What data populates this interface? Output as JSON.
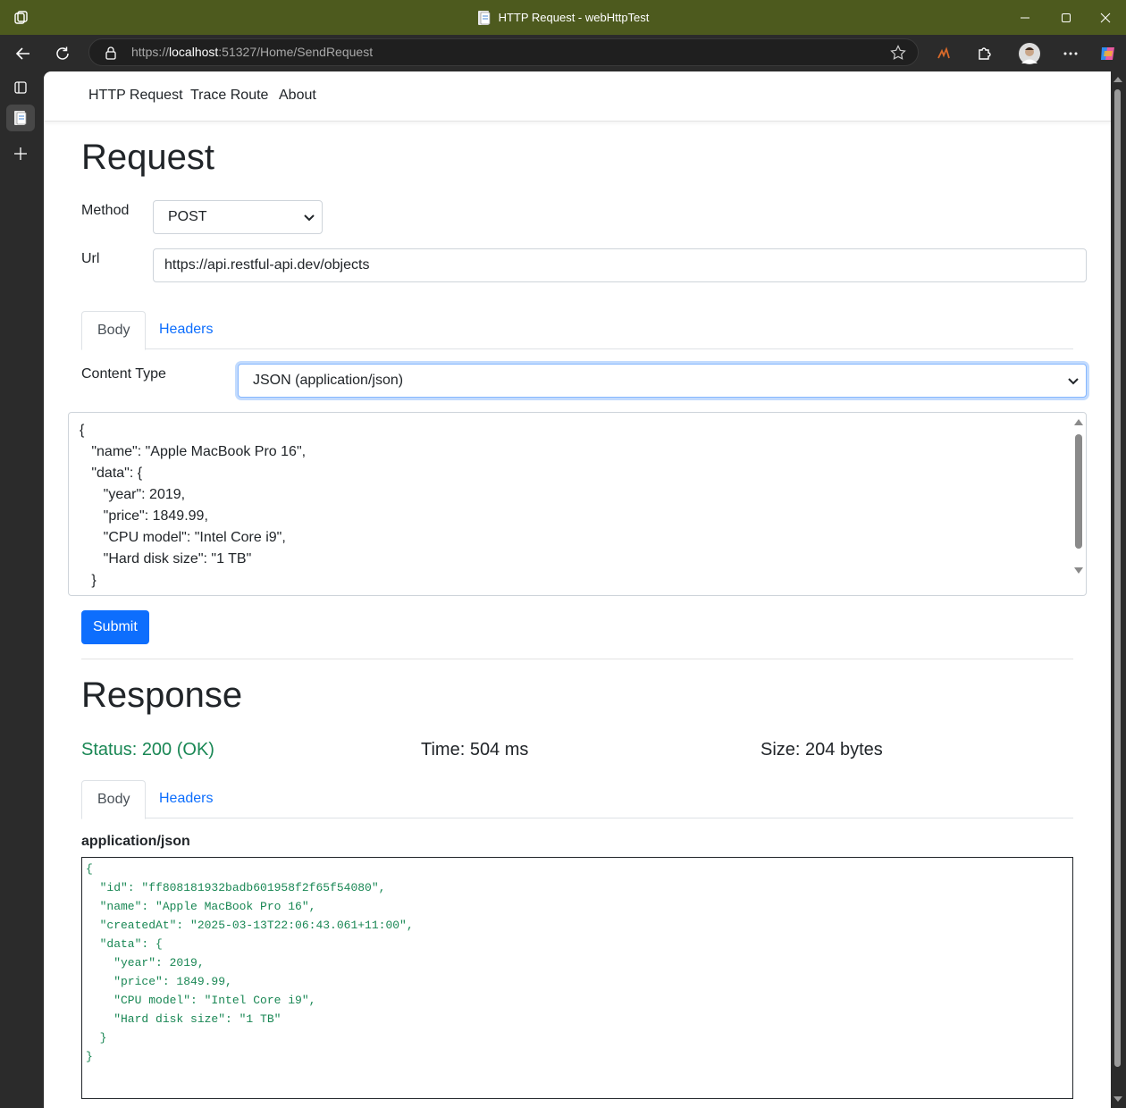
{
  "window": {
    "title": "HTTP Request - webHttpTest"
  },
  "browser": {
    "url_scheme": "https://",
    "url_host": "localhost",
    "url_rest": ":51327/Home/SendRequest"
  },
  "nav": {
    "items": [
      "HTTP Request",
      "Trace Route",
      "About"
    ]
  },
  "request": {
    "heading": "Request",
    "method_label": "Method",
    "method_value": "POST",
    "url_label": "Url",
    "url_value": "https://api.restful-api.dev/objects",
    "tabs": [
      "Body",
      "Headers"
    ],
    "content_type_label": "Content Type",
    "content_type_value": "JSON (application/json)",
    "body_text": "{\n   \"name\": \"Apple MacBook Pro 16\",\n   \"data\": {\n      \"year\": 2019,\n      \"price\": 1849.99,\n      \"CPU model\": \"Intel Core i9\",\n      \"Hard disk size\": \"1 TB\"\n   }",
    "submit_label": "Submit"
  },
  "response": {
    "heading": "Response",
    "status": "Status: 200 (OK)",
    "time": "Time: 504 ms",
    "size": "Size: 204 bytes",
    "tabs": [
      "Body",
      "Headers"
    ],
    "content_type": "application/json",
    "body_text": "{\n  \"id\": \"ff808181932badb601958f2f65f54080\",\n  \"name\": \"Apple MacBook Pro 16\",\n  \"createdAt\": \"2025-03-13T22:06:43.061+11:00\",\n  \"data\": {\n    \"year\": 2019,\n    \"price\": 1849.99,\n    \"CPU model\": \"Intel Core i9\",\n    \"Hard disk size\": \"1 TB\"\n  }\n}"
  },
  "colors": {
    "titlebar": "#4d5a1e",
    "primary": "#0d6efd",
    "success": "#198754"
  },
  "icons": [
    "app-menu-icon",
    "document-icon",
    "minimize-icon",
    "maximize-icon",
    "close-icon",
    "back-icon",
    "refresh-icon",
    "lock-icon",
    "favorite-star-icon",
    "extension-icon",
    "puzzle-icon",
    "profile-avatar",
    "more-icon",
    "copilot-icon",
    "tab-actions-icon",
    "vertical-tab-icon",
    "new-tab-icon",
    "chevron-down-icon"
  ]
}
